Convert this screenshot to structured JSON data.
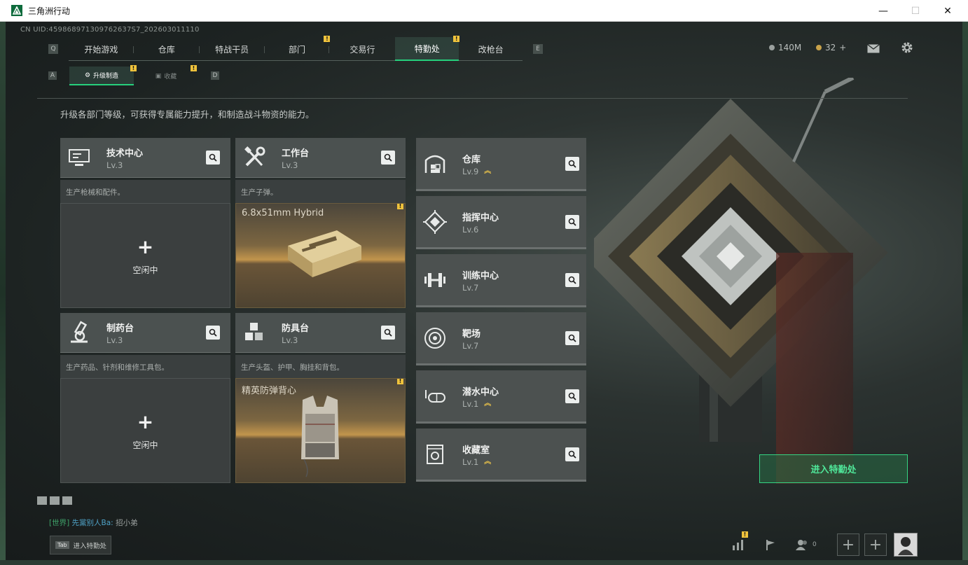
{
  "window": {
    "title": "三角洲行动",
    "minimize": "—",
    "maximize": "☐",
    "close": "✕"
  },
  "uid": "CN UID:459868971309762637S7_202603011110",
  "nav": {
    "key_left": "Q",
    "key_right": "E",
    "tabs": [
      {
        "label": "开始游戏",
        "badge": false
      },
      {
        "label": "仓库",
        "badge": false
      },
      {
        "label": "特战干员",
        "badge": false
      },
      {
        "label": "部门",
        "badge": true
      },
      {
        "label": "交易行",
        "badge": false
      },
      {
        "label": "特勤处",
        "badge": true,
        "active": true
      },
      {
        "label": "改枪台",
        "badge": false
      }
    ],
    "badge_mark": "!"
  },
  "subnav": {
    "key_left": "A",
    "key_right": "D",
    "tabs": [
      {
        "label": "升级制造",
        "active": true
      },
      {
        "label": "收藏",
        "active": false
      }
    ]
  },
  "currency": {
    "money": "140M",
    "coins": "32",
    "coins_add": "+"
  },
  "description": "升级各部门等级，可获得专属能力提升，和制造战斗物资的能力。",
  "workstations": [
    {
      "name": "技术中心",
      "level": "Lv.3",
      "desc": "生产枪械和配件。",
      "icon": "computer-icon",
      "status": "idle",
      "status_plus": "+",
      "status_label": "空闲中"
    },
    {
      "name": "工作台",
      "level": "Lv.3",
      "desc": "生产子弹。",
      "icon": "tools-icon",
      "status": "producing",
      "product": "6.8x51mm Hybrid"
    },
    {
      "name": "制药台",
      "level": "Lv.3",
      "desc": "生产药品、针剂和维修工具包。",
      "icon": "microscope-icon",
      "status": "idle",
      "status_plus": "+",
      "status_label": "空闲中"
    },
    {
      "name": "防具台",
      "level": "Lv.3",
      "desc": "生产头盔、护甲、胸挂和背包。",
      "icon": "cubes-icon",
      "status": "producing",
      "product": "精英防弹背心"
    }
  ],
  "facilities": [
    {
      "name": "仓库",
      "level": "Lv.9",
      "upgrade": true,
      "icon": "warehouse-icon"
    },
    {
      "name": "指挥中心",
      "level": "Lv.6",
      "upgrade": false,
      "icon": "command-chip-icon"
    },
    {
      "name": "训练中心",
      "level": "Lv.7",
      "upgrade": false,
      "icon": "dumbbell-icon"
    },
    {
      "name": "靶场",
      "level": "Lv.7",
      "upgrade": false,
      "icon": "target-icon"
    },
    {
      "name": "潜水中心",
      "level": "Lv.1",
      "upgrade": true,
      "icon": "diving-mask-icon"
    },
    {
      "name": "收藏室",
      "level": "Lv.1",
      "upgrade": true,
      "icon": "collection-icon"
    }
  ],
  "upgrade_mark": "︽",
  "enter_button": "进入特勤处",
  "chat": {
    "channel": "[世界]",
    "sender": "先黨别人Ba:",
    "message": "招小弟"
  },
  "tab_hint": {
    "key": "Tab",
    "label": "进入特勤处"
  },
  "bottom": {
    "friends_count": "0",
    "add": "+"
  },
  "colors": {
    "accent": "#26d07c",
    "badge": "#f0c33c",
    "upgrade": "#e9c24a"
  }
}
